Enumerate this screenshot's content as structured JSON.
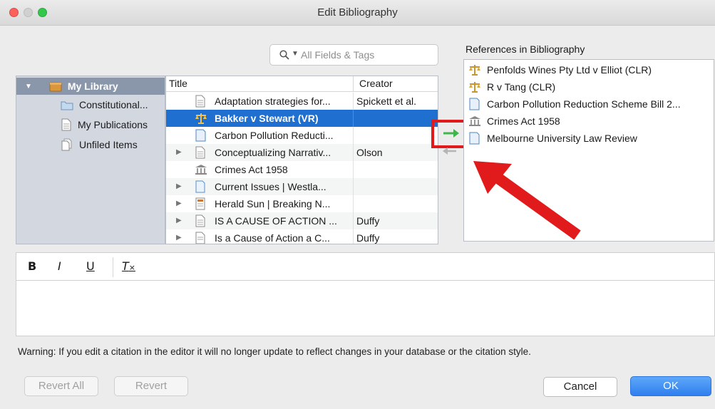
{
  "window": {
    "title": "Edit Bibliography"
  },
  "search": {
    "placeholder": "All Fields & Tags"
  },
  "library": {
    "root": "My Library",
    "children": [
      "Constitutional...",
      "My Publications",
      "Unfiled Items"
    ]
  },
  "items": {
    "columns": {
      "title": "Title",
      "creator": "Creator"
    },
    "rows": [
      {
        "title": "Adaptation strategies for...",
        "creator": "Spickett et al.",
        "icon": "document-icon",
        "expandable": false
      },
      {
        "title": "Bakker v Stewart (VR)",
        "creator": "",
        "icon": "case-scales-icon",
        "expandable": false,
        "selected": true
      },
      {
        "title": "Carbon Pollution Reducti...",
        "creator": "",
        "icon": "bill-icon",
        "expandable": false
      },
      {
        "title": "Conceptualizing Narrativ...",
        "creator": "Olson",
        "icon": "document-icon",
        "expandable": true
      },
      {
        "title": "Crimes Act 1958",
        "creator": "",
        "icon": "statute-icon",
        "expandable": false
      },
      {
        "title": "Current Issues | Westla...",
        "creator": "",
        "icon": "webpage-icon",
        "expandable": true
      },
      {
        "title": "Herald Sun | Breaking N...",
        "creator": "",
        "icon": "newspaper-icon",
        "expandable": true
      },
      {
        "title": "IS A CAUSE OF ACTION ...",
        "creator": "Duffy",
        "icon": "document-icon",
        "expandable": true
      },
      {
        "title": "Is a Cause of Action a C...",
        "creator": "Duffy",
        "icon": "document-icon",
        "expandable": true
      }
    ]
  },
  "references": {
    "label": "References in Bibliography",
    "items": [
      {
        "title": "Penfolds Wines Pty Ltd v Elliot (CLR)",
        "icon": "case-scales-icon"
      },
      {
        "title": "R v Tang (CLR)",
        "icon": "case-scales-icon"
      },
      {
        "title": "Carbon Pollution Reduction Scheme Bill 2...",
        "icon": "bill-icon"
      },
      {
        "title": "Crimes Act 1958",
        "icon": "statute-icon"
      },
      {
        "title": "Melbourne University Law Review",
        "icon": "journal-icon"
      }
    ]
  },
  "editor": {
    "bold": "B",
    "italic": "I",
    "underline": "U",
    "clear": "T",
    "warning": "Warning: If you edit a citation in the editor it will no longer update to reflect changes in your database or the citation style."
  },
  "buttons": {
    "revert_all": "Revert All",
    "revert": "Revert",
    "cancel": "Cancel",
    "ok": "OK"
  },
  "colors": {
    "accent": "#1f6fd1",
    "highlight": "#e11b1b",
    "add_arrow": "#3fb54a"
  }
}
